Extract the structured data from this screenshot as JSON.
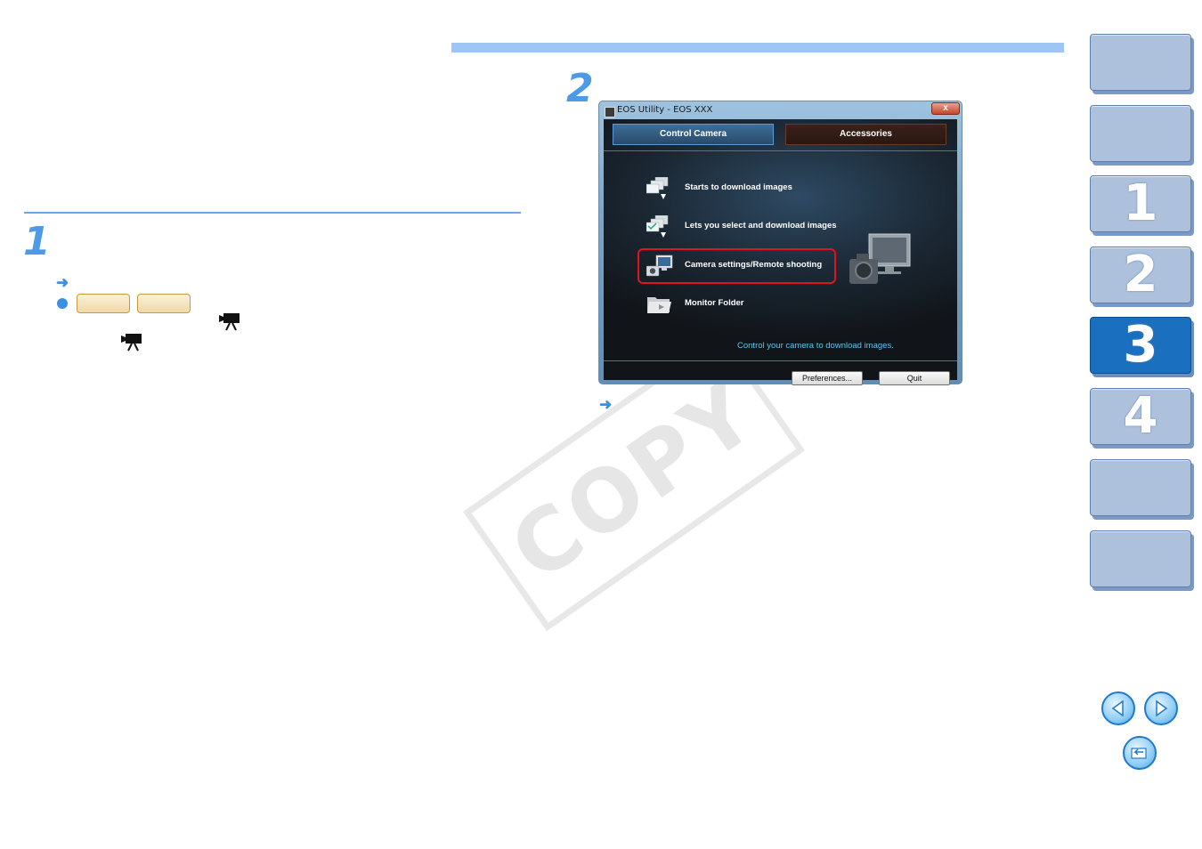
{
  "window": {
    "title": "EOS Utility - EOS XXX",
    "close": "x",
    "tabs": {
      "control_camera": "Control Camera",
      "accessories": "Accessories"
    },
    "menu": [
      "Starts to download images",
      "Lets you select and download images",
      "Camera settings/Remote shooting",
      "Monitor Folder"
    ],
    "hint": "Control your camera to download images.",
    "buttons": {
      "preferences": "Preferences...",
      "quit": "Quit"
    }
  },
  "steps": {
    "step1": "1",
    "step2": "2"
  },
  "watermark": "COPY",
  "nav_tabs": [
    "",
    "",
    "1",
    "2",
    "3",
    "4",
    "",
    ""
  ],
  "nav_active_index": 4,
  "colors": {
    "accent": "#4d9be6",
    "active_tab": "#1a6fbf",
    "inactive_tab": "#adc1dc",
    "highlight": "#e0141e"
  }
}
